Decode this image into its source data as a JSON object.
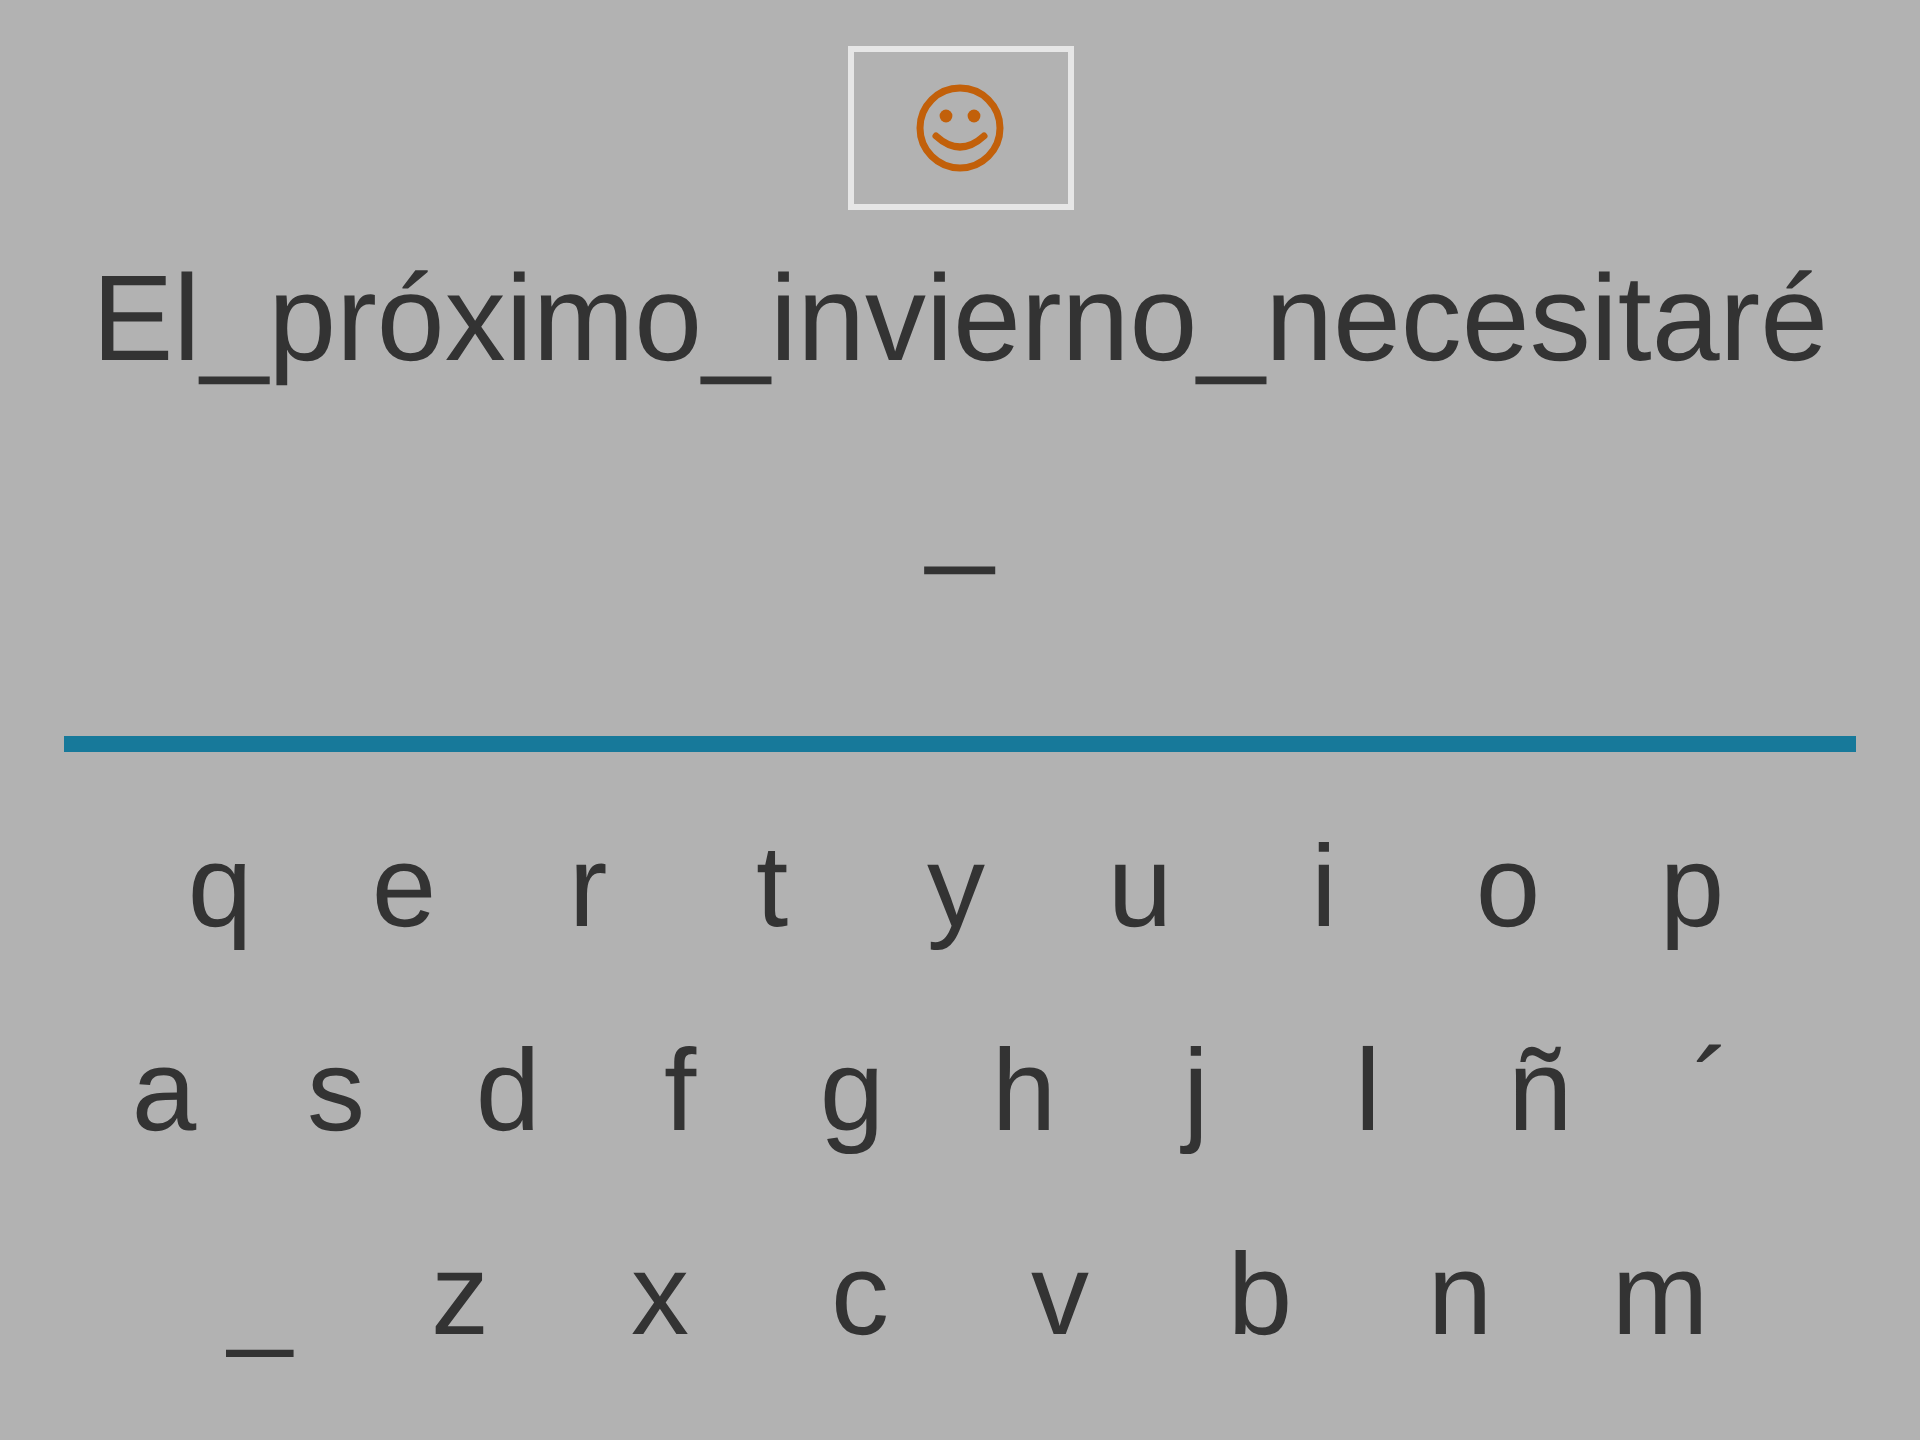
{
  "feedback": {
    "kind": "smiley"
  },
  "sentence": "El_próximo_invierno_necesitaré _",
  "keyboard": {
    "top_row": [
      "q",
      "e",
      "r",
      "t",
      "y",
      "u",
      "i",
      "o",
      "p"
    ],
    "middle_row": [
      "a",
      "s",
      "d",
      "f",
      "g",
      "h",
      "j",
      "l",
      "ñ",
      "´"
    ],
    "bottom_row": [
      "_",
      "z",
      "x",
      "c",
      "v",
      "b",
      "n",
      "m"
    ]
  }
}
